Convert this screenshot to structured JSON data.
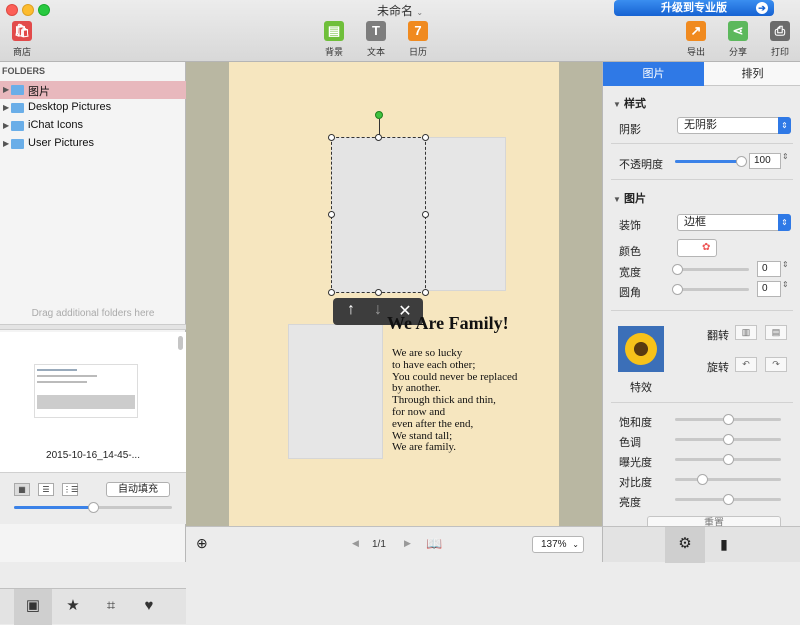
{
  "window": {
    "title": "未命名",
    "upgrade_label": "升级到专业版"
  },
  "toolbar": {
    "store": "商店",
    "background": "背景",
    "text": "文本",
    "calendar": "日历",
    "export": "导出",
    "share": "分享",
    "print": "打印"
  },
  "sidebar": {
    "header": "FOLDERS",
    "folders": [
      "图片",
      "Desktop Pictures",
      "iChat Icons",
      "User Pictures"
    ],
    "drag_hint": "Drag additional folders here",
    "thumb_caption": "2015-10-16_14-45-...",
    "autofill_label": "自动填充",
    "thumb_size_fraction": 0.5
  },
  "canvas": {
    "title": "We Are Family!",
    "poem": [
      "We are so lucky",
      "to have each other;",
      "You could never be replaced",
      "by another.",
      "Through thick and thin,",
      "for now and",
      "even after the end,",
      "We stand tall;",
      "We are family."
    ],
    "page_indicator": "1/1",
    "zoom": "137%"
  },
  "inspector": {
    "tabs": [
      "图片",
      "排列"
    ],
    "style_section": "样式",
    "shadow_label": "阴影",
    "shadow_value": "无阴影",
    "opacity_label": "不透明度",
    "opacity_value": "100",
    "picture_section": "图片",
    "decoration_label": "装饰",
    "decoration_value": "边框",
    "color_label": "颜色",
    "width_label": "宽度",
    "width_value": "0",
    "corner_label": "圆角",
    "corner_value": "0",
    "flip_label": "翻转",
    "rotate_label": "旋转",
    "effects_label": "特效",
    "adjustments": [
      "饱和度",
      "色调",
      "曝光度",
      "对比度",
      "亮度"
    ],
    "reset_label": "重置",
    "accent_color": "#2f79e6"
  }
}
